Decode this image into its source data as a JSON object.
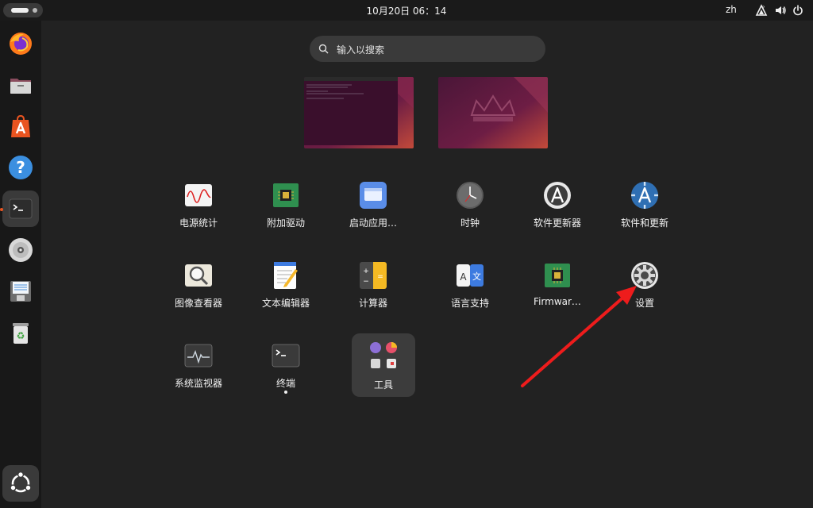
{
  "topbar": {
    "clock": "10月20日  06：14",
    "language": "zh"
  },
  "search": {
    "placeholder": "输入以搜索"
  },
  "dock": {
    "items": [
      "firefox-icon",
      "files-icon",
      "app-center-icon",
      "help-icon",
      "terminal-icon",
      "disc-icon",
      "save-icon",
      "trash-icon"
    ],
    "running": "terminal"
  },
  "apps": {
    "power_stats": "电源统计",
    "additional_drivers": "附加驱动",
    "startup_apps": "启动应用…",
    "clocks": "时钟",
    "software_updater": "软件更新器",
    "software_updates": "软件和更新",
    "image_viewer": "图像查看器",
    "text_editor": "文本编辑器",
    "calculator": "计算器",
    "language_support": "语言支持",
    "firmware": "Firmwar…",
    "settings": "设置",
    "system_monitor": "系统监视器",
    "terminal": "终端",
    "tools_folder": "工具"
  },
  "colors": {
    "accent": "#e95420",
    "annotation_arrow": "#ee1c1c",
    "background": "#222222",
    "dock": "#181818"
  }
}
